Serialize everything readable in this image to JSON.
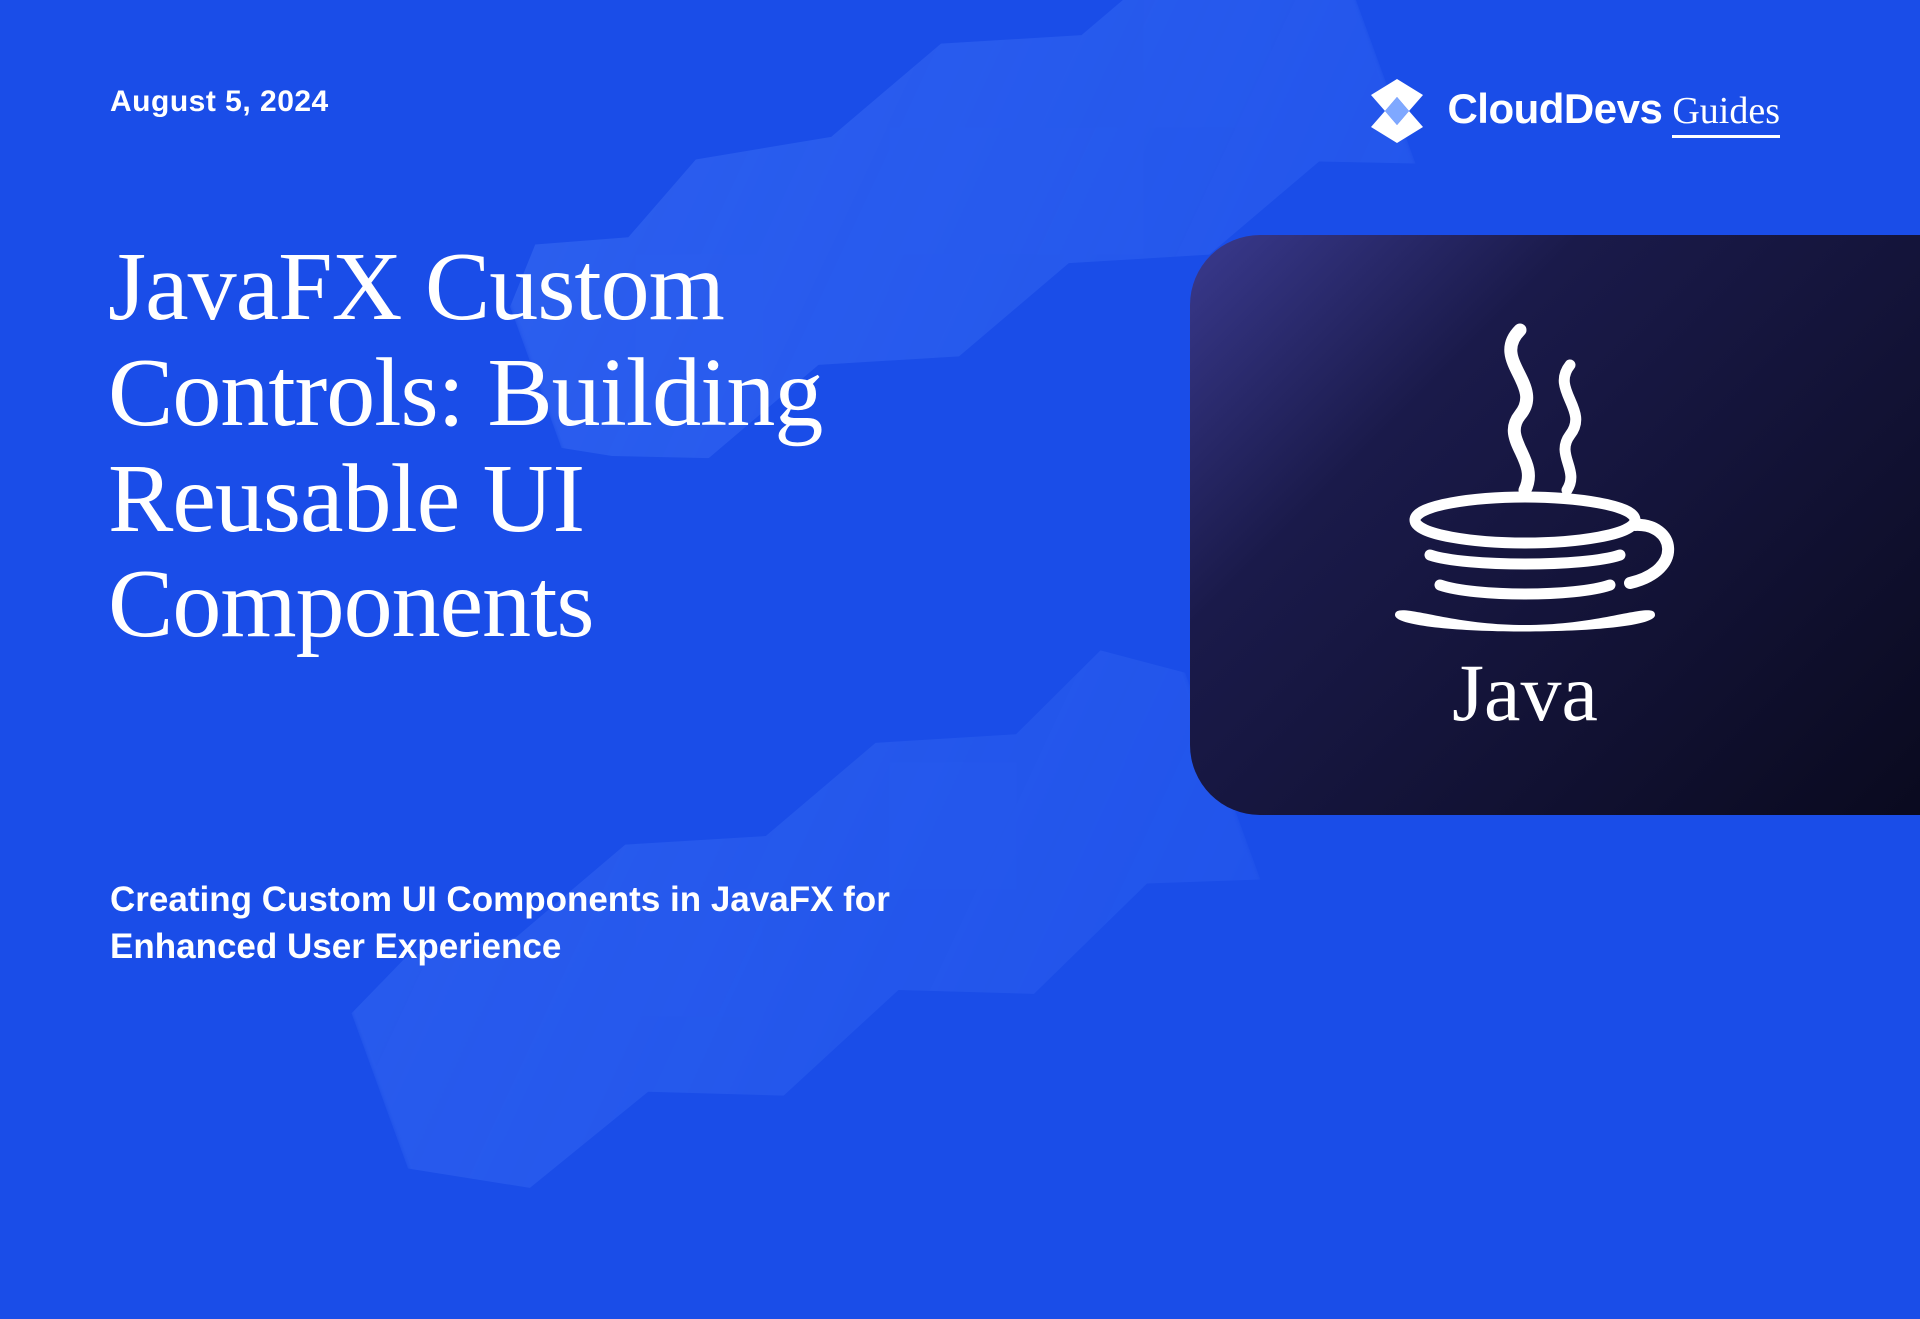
{
  "date": "August 5, 2024",
  "logo": {
    "brand": "CloudDevs",
    "suffix": "Guides"
  },
  "title": "JavaFX Custom Controls: Building Reusable UI Components",
  "subtitle": "Creating Custom UI Components in JavaFX for Enhanced User Experience",
  "feature": {
    "tech_name": "Java",
    "icon": "java-logo"
  }
}
